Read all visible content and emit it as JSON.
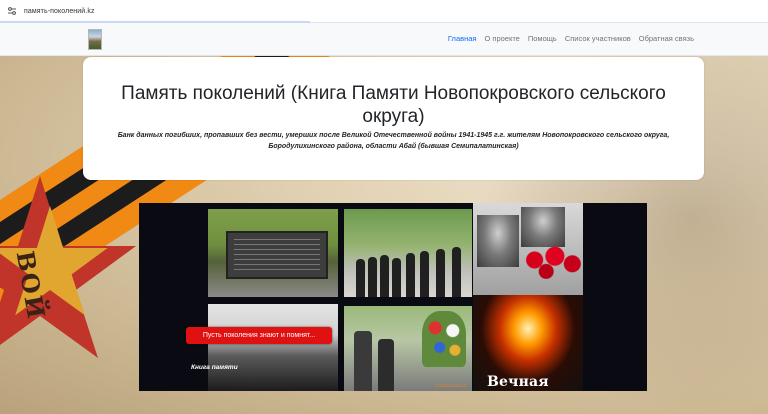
{
  "browser": {
    "url": "память-поколений.kz"
  },
  "navbar": {
    "links": [
      {
        "label": "Главная",
        "active": true
      },
      {
        "label": "О проекте",
        "active": false
      },
      {
        "label": "Помощь",
        "active": false
      },
      {
        "label": "Список участников",
        "active": false
      },
      {
        "label": "Обратная связь",
        "active": false
      }
    ]
  },
  "header": {
    "title": "Память поколений (Книга Памяти Новопокровского сельского округа)",
    "subtitle": "Банк данных погибших, пропавших без вести, умерших после Великой Отечественной войны 1941-1945 г.г. жителям Новопокровского сельского округа, Бородулихинского района, области Абай (бывшая Семипалатинская)"
  },
  "collage": {
    "button_label": "Пусть поколения знают и помнят...",
    "book_label": "Книга памяти",
    "photo_timestamp": "27/08/2013 18:13",
    "flame_caption": "Вечная"
  },
  "colors": {
    "nav_active": "#0d6efd",
    "nav_link": "#6c757d",
    "button_red": "#e01111",
    "ribbon_orange": "#f08a14",
    "ribbon_black": "#1c1c1c"
  }
}
